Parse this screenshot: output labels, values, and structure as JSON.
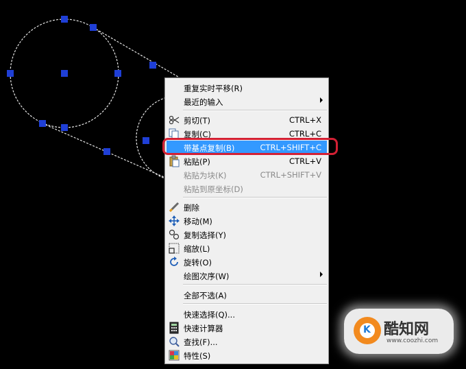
{
  "colors": {
    "background": "#000000",
    "grip": "#1f3fd6",
    "highlight": "#3399ff",
    "callout": "#d32034",
    "watermark_accent": "#f28a1e"
  },
  "menu": {
    "items": [
      {
        "label": "重复实时平移(R)",
        "shortcut": "",
        "submenu": false,
        "disabled": false,
        "icon": ""
      },
      {
        "label": "最近的输入",
        "shortcut": "",
        "submenu": true,
        "disabled": false,
        "icon": ""
      },
      {
        "label": "剪切(T)",
        "shortcut": "CTRL+X",
        "submenu": false,
        "disabled": false,
        "icon": "scissors-icon"
      },
      {
        "label": "复制(C)",
        "shortcut": "CTRL+C",
        "submenu": false,
        "disabled": false,
        "icon": "copy-icon"
      },
      {
        "label": "带基点复制(B)",
        "shortcut": "CTRL+SHIFT+C",
        "submenu": false,
        "disabled": false,
        "icon": "",
        "highlighted": true
      },
      {
        "label": "粘贴(P)",
        "shortcut": "CTRL+V",
        "submenu": false,
        "disabled": false,
        "icon": "paste-icon"
      },
      {
        "label": "粘贴为块(K)",
        "shortcut": "CTRL+SHIFT+V",
        "submenu": false,
        "disabled": true,
        "icon": ""
      },
      {
        "label": "粘贴到原坐标(D)",
        "shortcut": "",
        "submenu": false,
        "disabled": true,
        "icon": ""
      },
      {
        "label": "删除",
        "shortcut": "",
        "submenu": false,
        "disabled": false,
        "icon": "eraser-icon"
      },
      {
        "label": "移动(M)",
        "shortcut": "",
        "submenu": false,
        "disabled": false,
        "icon": "move-icon"
      },
      {
        "label": "复制选择(Y)",
        "shortcut": "",
        "submenu": false,
        "disabled": false,
        "icon": "copy-selection-icon"
      },
      {
        "label": "缩放(L)",
        "shortcut": "",
        "submenu": false,
        "disabled": false,
        "icon": "scale-icon"
      },
      {
        "label": "旋转(O)",
        "shortcut": "",
        "submenu": false,
        "disabled": false,
        "icon": "rotate-icon"
      },
      {
        "label": "绘图次序(W)",
        "shortcut": "",
        "submenu": true,
        "disabled": false,
        "icon": ""
      },
      {
        "label": "全部不选(A)",
        "shortcut": "",
        "submenu": false,
        "disabled": false,
        "icon": ""
      },
      {
        "label": "快速选择(Q)...",
        "shortcut": "",
        "submenu": false,
        "disabled": false,
        "icon": ""
      },
      {
        "label": "快速计算器",
        "shortcut": "",
        "submenu": false,
        "disabled": false,
        "icon": "calculator-icon"
      },
      {
        "label": "查找(F)...",
        "shortcut": "",
        "submenu": false,
        "disabled": false,
        "icon": "find-icon"
      },
      {
        "label": "特性(S)",
        "shortcut": "",
        "submenu": false,
        "disabled": false,
        "icon": "properties-icon"
      }
    ]
  },
  "watermark": {
    "title": "酷知网",
    "url": "www.coozhi.com",
    "logo_letter": "K"
  }
}
